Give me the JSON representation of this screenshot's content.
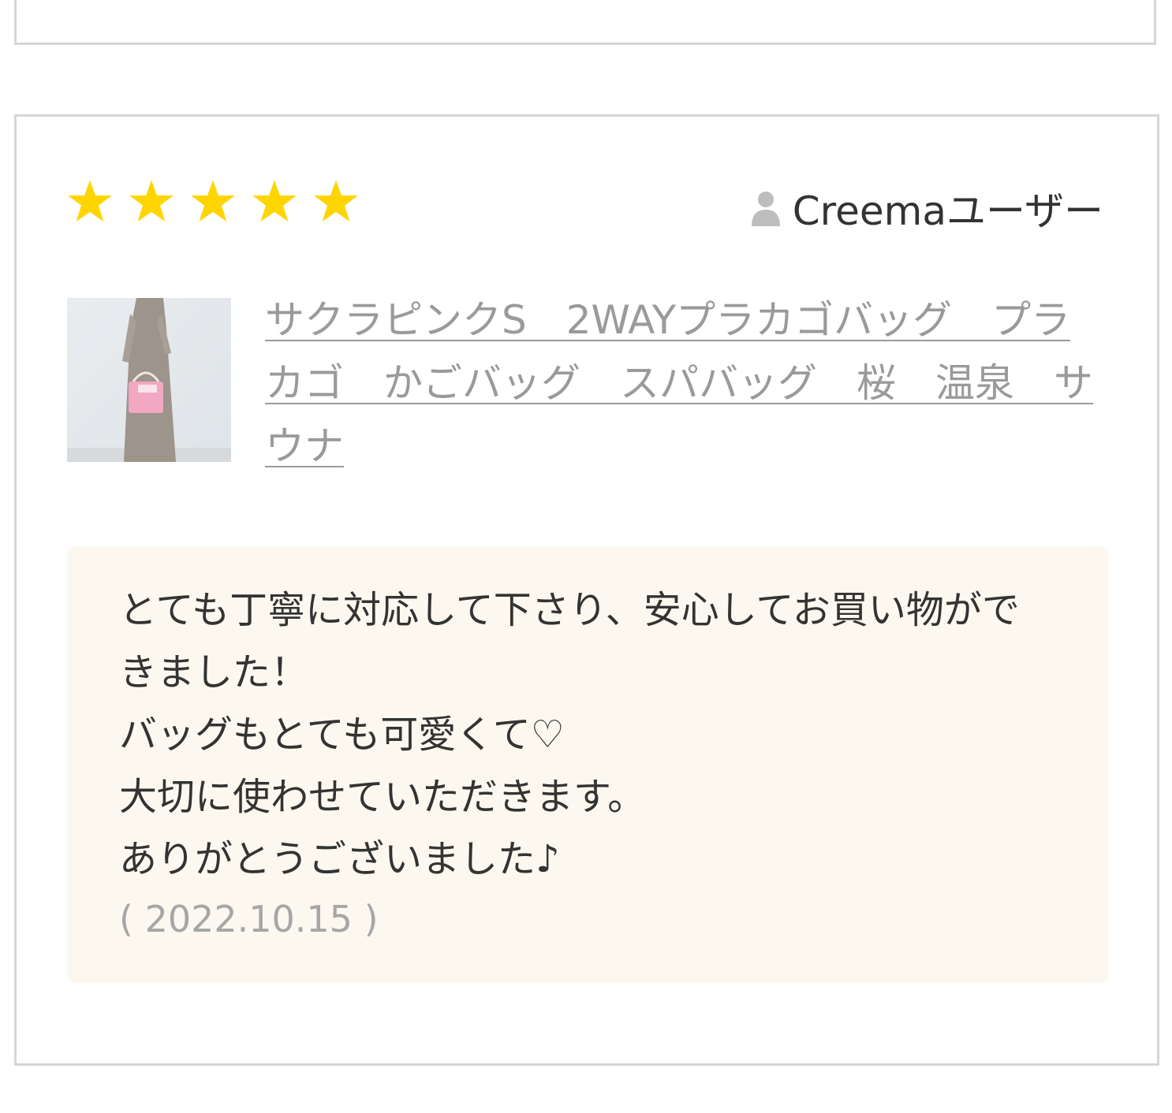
{
  "review": {
    "rating": 5,
    "rating_max": 5,
    "star_color": "#ffd500",
    "reviewer": {
      "icon": "user-icon",
      "name": "Creemaユーザー"
    },
    "product": {
      "thumbnail_icon": "product-thumbnail",
      "title": "サクラピンクS　2WAYプラカゴバッグ　プラカゴ　かごバッグ　スパバッグ　桜　温泉　サウナ"
    },
    "comment_lines": [
      "とても丁寧に対応して下さり、安心してお買い物がで",
      "きました！",
      "バッグもとても可愛くて♡",
      "大切に使わせていただきます。",
      "ありがとうございました♪"
    ],
    "date": "( 2022.10.15 )"
  },
  "colors": {
    "border": "#d6d6d6",
    "comment_background": "#fcf8ef",
    "link_text": "#9a9a9a",
    "date_text": "#a6a6a6"
  }
}
